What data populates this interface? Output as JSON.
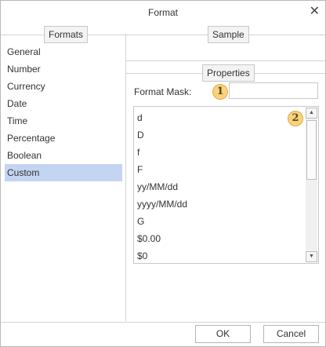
{
  "dialog": {
    "title": "Format",
    "close_glyph": "✕"
  },
  "formats_panel": {
    "header": "Formats",
    "items": [
      "General",
      "Number",
      "Currency",
      "Date",
      "Time",
      "Percentage",
      "Boolean",
      "Custom"
    ],
    "selected": "Custom"
  },
  "sample_panel": {
    "header": "Sample"
  },
  "properties_panel": {
    "header": "Properties",
    "format_mask_label": "Format Mask:",
    "format_mask_value": "",
    "masks": [
      "d",
      "D",
      "f",
      "F",
      "yy/MM/dd",
      "yyyy/MM/dd",
      "G",
      "$0.00",
      "$0"
    ]
  },
  "callouts": {
    "one": "1",
    "two": "2"
  },
  "footer": {
    "ok_label": "OK",
    "cancel_label": "Cancel"
  },
  "icons": {
    "close": "close-icon",
    "scroll_up": "scroll-up-arrow-icon",
    "scroll_down": "scroll-down-arrow-icon"
  },
  "colors": {
    "selected_bg": "#c4d4f3",
    "callout_fill": "#f9d27d"
  }
}
